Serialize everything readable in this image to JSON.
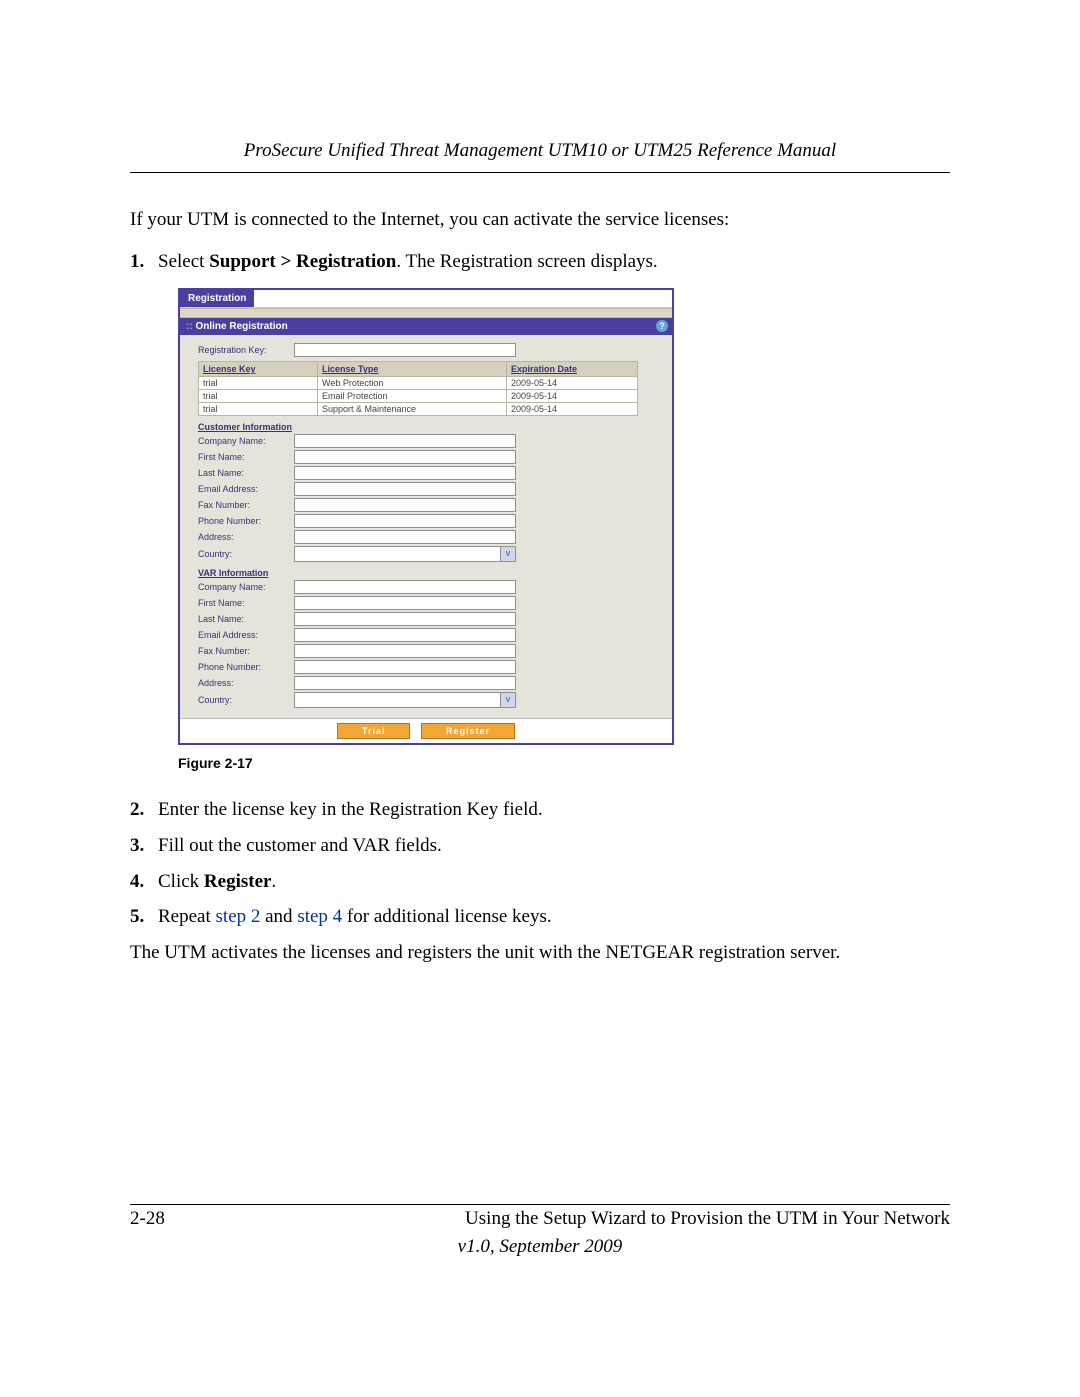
{
  "header": "ProSecure Unified Threat Management UTM10 or UTM25 Reference Manual",
  "intro": "If your UTM is connected to the Internet, you can activate the service licenses:",
  "step1_prefix": "Select ",
  "step1_bold": "Support > Registration",
  "step1_suffix": ". The Registration screen displays.",
  "fig_caption": "Figure 2-17",
  "step2": "Enter the license key in the Registration Key field.",
  "step3": "Fill out the customer and VAR fields.",
  "step4_prefix": "Click ",
  "step4_bold": "Register",
  "step4_suffix": ".",
  "step5_a": "Repeat ",
  "step5_link1": "step 2",
  "step5_b": " and ",
  "step5_link2": "step 4",
  "step5_c": " for additional license keys.",
  "closing": "The UTM activates the licenses and registers the unit with the NETGEAR registration server.",
  "footer_page": "2-28",
  "footer_right": "Using the Setup Wizard to Provision the UTM in Your Network",
  "footer_ver": "v1.0, September 2009",
  "shot": {
    "tab": "Registration",
    "section": "Online Registration",
    "regkey_label": "Registration Key:",
    "th_key": "License Key",
    "th_type": "License Type",
    "th_exp": "Expiration Date",
    "rows": [
      {
        "k": "trial",
        "t": "Web Protection",
        "e": "2009-05-14"
      },
      {
        "k": "trial",
        "t": "Email Protection",
        "e": "2009-05-14"
      },
      {
        "k": "trial",
        "t": "Support & Maintenance",
        "e": "2009-05-14"
      }
    ],
    "cust_hdr": "Customer Information",
    "var_hdr": "VAR Information",
    "labels": {
      "company": "Company Name:",
      "first": "First Name:",
      "last": "Last Name:",
      "email": "Email Address:",
      "fax": "Fax Number:",
      "phone": "Phone Number:",
      "addr": "Address:",
      "country": "Country:"
    },
    "btn_trial": "Trial",
    "btn_register": "Register"
  }
}
